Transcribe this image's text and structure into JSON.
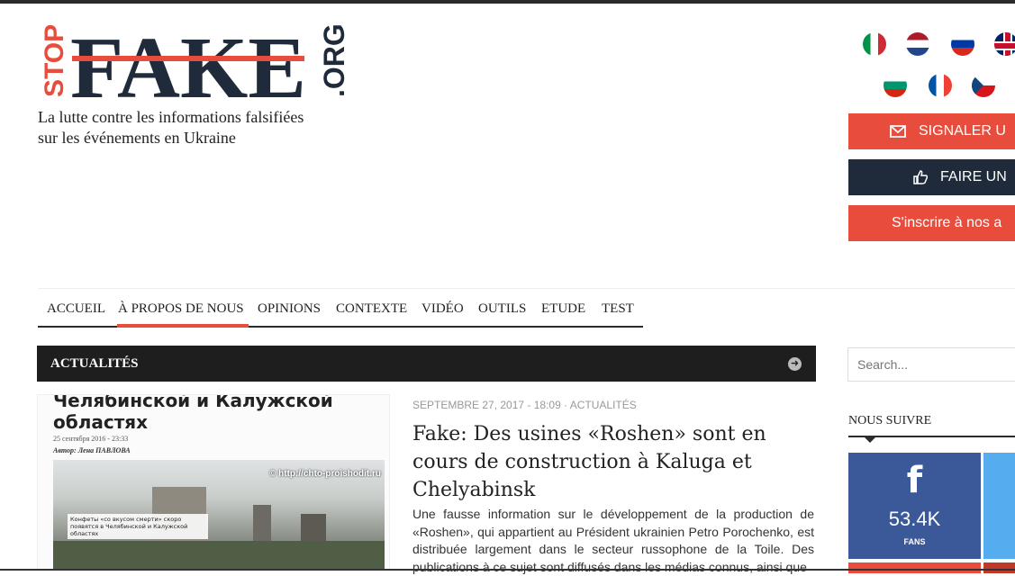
{
  "brand": {
    "logo_stop": "STOP",
    "logo_fake": "FAKE",
    "logo_org": ".ORG",
    "tagline_line1": "La lutte contre les informations falsifiées",
    "tagline_line2": "sur les événements en Ukraine"
  },
  "languages": [
    "Italian",
    "Dutch",
    "Russian",
    "English",
    "Bulgarian",
    "French",
    "Czech"
  ],
  "actions": {
    "report_label": "SIGNALER U",
    "donate_label": "FAIRE UN",
    "subscribe_label": "S'inscrire à nos a"
  },
  "nav": {
    "items": [
      "ACCUEIL",
      "À PROPOS DE NOUS",
      "OPINIONS",
      "CONTEXTE",
      "VIDÉO",
      "OUTILS",
      "ETUDE",
      "TEST"
    ],
    "active": "À PROPOS DE NOUS"
  },
  "section": {
    "title": "ACTUALITÉS"
  },
  "article": {
    "meta": "SEPTEMBRE 27, 2017 - 18:09 · ACTUALITÉS",
    "title": "Fake: Des usines «Roshen» sont en cours de construction à Kaluga et Chelyabinsk",
    "excerpt": "Une fausse information sur le développement de la production de «Roshen», qui appartient au Président ukrainien Petro Porochenko, est distribuée largement dans le secteur russophone de la Toile. Des publications à ce sujet sont diffusés dans les médias connus, ainsi que",
    "thumb": {
      "headline": "Челябинской и Калужской областях",
      "date": "25 сентября 2016 - 23:33",
      "author": "Автор: Лена ПАВЛОВА",
      "watermark": "© http://chto-proishodit.ru",
      "caption": "Конфеты «со вкусом смерти» скоро появятся в Челябинской и Калужской областях"
    }
  },
  "sidebar": {
    "search_placeholder": "Search...",
    "follow_title": "NOUS SUIVRE",
    "facebook_count": "53.4K",
    "facebook_label": "FANS"
  },
  "colors": {
    "accent_red": "#e74c3c",
    "dark_navy": "#1f2b3a",
    "facebook_blue": "#3b5998",
    "twitter_blue": "#55acee"
  },
  "icons": {
    "report": "envelope-icon",
    "donate": "thumbs-up-icon",
    "section": "arrow-circle-icon",
    "facebook": "facebook-icon"
  }
}
